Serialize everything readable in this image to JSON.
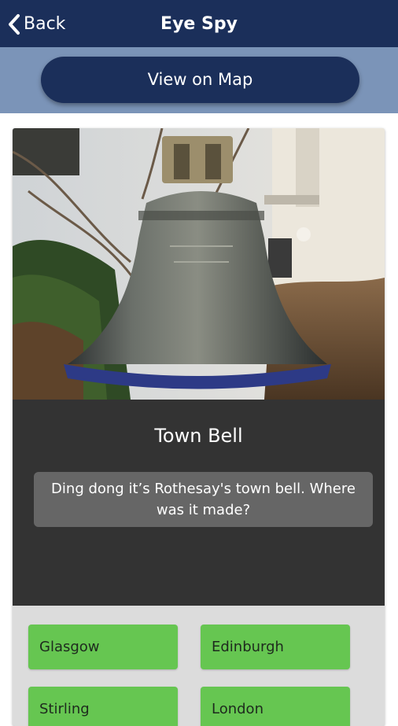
{
  "header": {
    "back_label": "Back",
    "title": "Eye Spy"
  },
  "map_button": {
    "label": "View on Map"
  },
  "item": {
    "title": "Town Bell",
    "question": "Ding dong it’s Rothesay's town bell. Where was it made?"
  },
  "answers": [
    "Glasgow",
    "Edinburgh",
    "Stirling",
    "London"
  ],
  "colors": {
    "header_bg": "#1b2f5a",
    "mapbar_bg": "#7b94b8",
    "info_bg": "#333333",
    "question_bg": "#666666",
    "answer_bg": "#66c651"
  },
  "icons": {
    "back": "chevron-left-icon"
  }
}
